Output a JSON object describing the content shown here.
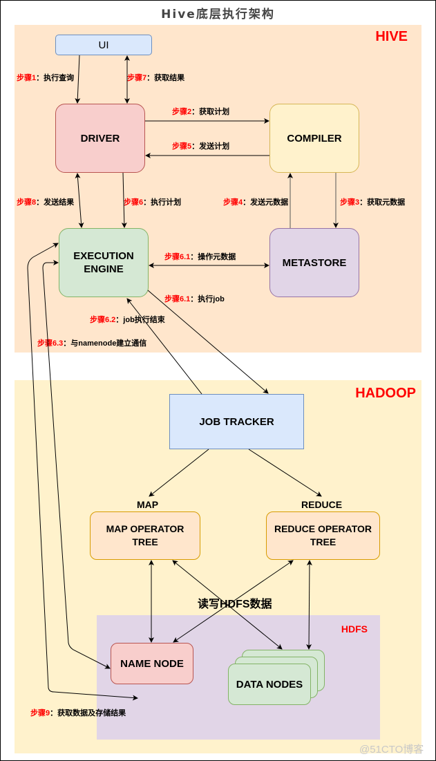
{
  "title": "Hive底层执行架构",
  "regions": {
    "hive": "HIVE",
    "hadoop": "HADOOP",
    "hdfs": "HDFS"
  },
  "nodes": {
    "ui": "UI",
    "driver": "DRIVER",
    "compiler": "COMPILER",
    "execution_engine_line1": "EXECUTION",
    "execution_engine_line2": "ENGINE",
    "metastore": "METASTORE",
    "job_tracker": "JOB TRACKER",
    "map_label": "MAP",
    "reduce_label": "REDUCE",
    "map_tree_line1": "MAP OPERATOR",
    "map_tree_line2": "TREE",
    "reduce_tree_line1": "REDUCE OPERATOR",
    "reduce_tree_line2": "TREE",
    "name_node": "NAME NODE",
    "data_nodes": "DATA NODES"
  },
  "steps": [
    {
      "num": "步骤1",
      "text": "：执行查询"
    },
    {
      "num": "步骤7",
      "text": "：获取结果"
    },
    {
      "num": "步骤2",
      "text": "：获取计划"
    },
    {
      "num": "步骤5",
      "text": "：发送计划"
    },
    {
      "num": "步骤8",
      "text": "：发送结果"
    },
    {
      "num": "步骤6",
      "text": "：执行计划"
    },
    {
      "num": "步骤4",
      "text": "：发送元数据"
    },
    {
      "num": "步骤3",
      "text": "：获取元数据"
    },
    {
      "num": "步骤6.1",
      "text": "：操作元数据"
    },
    {
      "num": "步骤6.1",
      "text": "：执行job"
    },
    {
      "num": "步骤6.2",
      "text": "：job执行结束"
    },
    {
      "num": "步骤6.3",
      "text": "：与namenode建立通信"
    },
    {
      "num": "步骤9",
      "text": "：获取数据及存储结果"
    }
  ],
  "hdfs_rw_label": "读写HDFS数据",
  "watermark": "@51CTO博客"
}
